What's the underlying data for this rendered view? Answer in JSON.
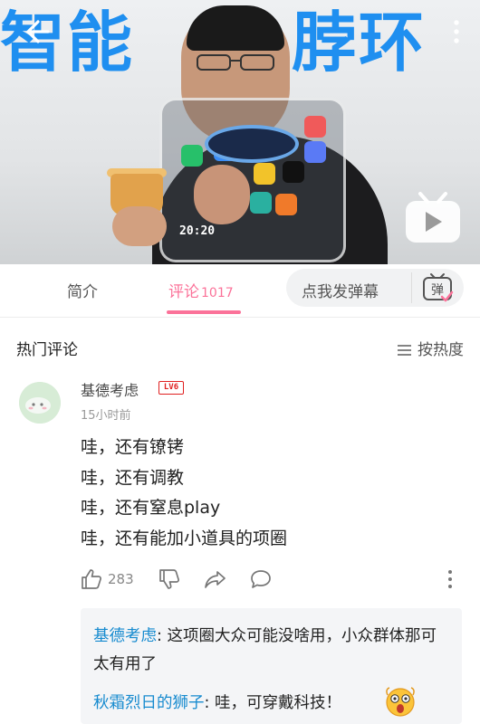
{
  "video": {
    "title_left": "智能",
    "title_right": "脖环",
    "tablet_clock": "20:20",
    "icons": {
      "back": "back-arrow-icon",
      "more": "more-vertical-icon",
      "logo": "bilibili-tv-icon"
    }
  },
  "tabs": {
    "intro_label": "简介",
    "comments_label": "评论",
    "comments_count": "1017",
    "danmaku_placeholder": "点我发弹幕",
    "danmaku_icon_label": "弹",
    "accent_color": "#fb7299"
  },
  "comments_header": {
    "title": "热门评论",
    "sort_label": "按热度"
  },
  "comment": {
    "username": "基德考虑",
    "level": "LV6",
    "time": "15小时前",
    "lines": [
      "哇，还有镣铐",
      "哇，还有调教",
      "哇，还有窒息play",
      "哇，还有能加小道具的项圈"
    ],
    "likes": "283",
    "icons": [
      "thumbs-up-icon",
      "thumbs-down-icon",
      "share-icon",
      "reply-icon",
      "more-vertical-icon"
    ]
  },
  "replies": [
    {
      "user": "基德考虑",
      "text": ": 这项圈大众可能没啥用，小众群体那可太有用了"
    },
    {
      "user": "秋霜烈日的狮子",
      "text": ": 哇，可穿戴科技！"
    }
  ],
  "colors": {
    "link_blue": "#178bcf",
    "title_blue": "#1f8ff0",
    "level_red": "#e02020"
  }
}
